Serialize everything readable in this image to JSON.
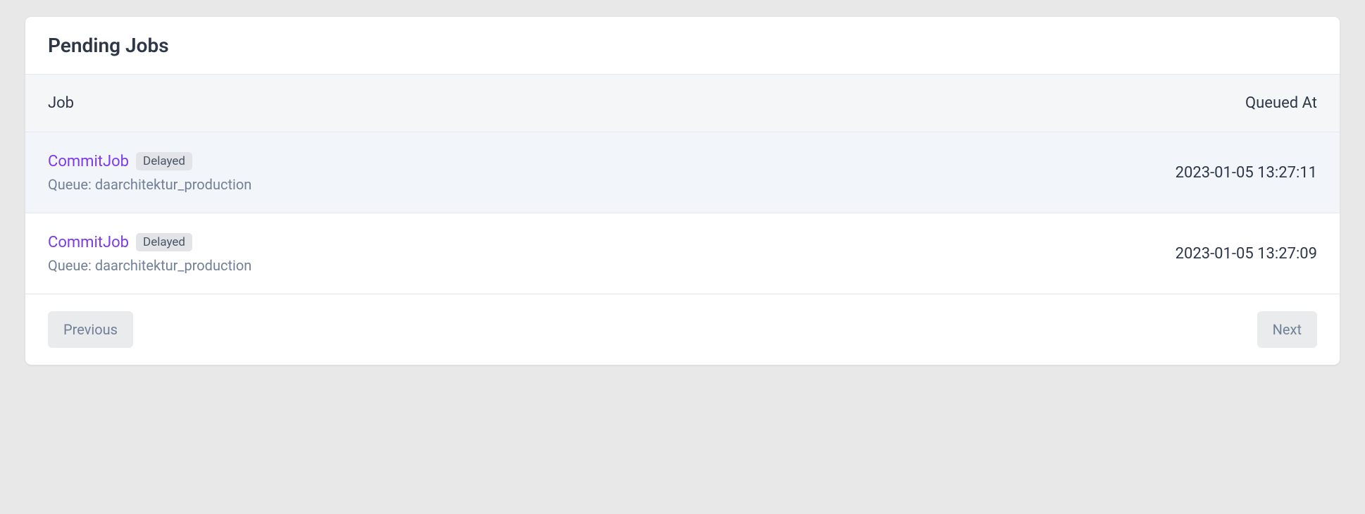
{
  "header": {
    "title": "Pending Jobs"
  },
  "columns": {
    "job": "Job",
    "queued_at": "Queued At"
  },
  "jobs": [
    {
      "name": "CommitJob",
      "status": "Delayed",
      "queue_label": "Queue: daarchitektur_production",
      "queued_at": "2023-01-05 13:27:11",
      "highlight": true
    },
    {
      "name": "CommitJob",
      "status": "Delayed",
      "queue_label": "Queue: daarchitektur_production",
      "queued_at": "2023-01-05 13:27:09",
      "highlight": false
    }
  ],
  "pagination": {
    "previous": "Previous",
    "next": "Next"
  }
}
